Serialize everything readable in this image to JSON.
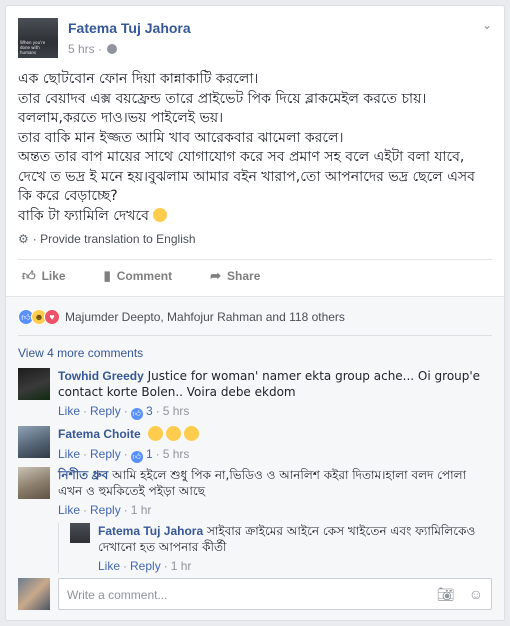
{
  "post": {
    "author": "Fatema Tuj Jahora",
    "avatar_caption": "When you're done with humans",
    "time": "5 hrs",
    "body_lines": [
      "এক ছোটবোন ফোন দিয়া কান্নাকাটি করলো।",
      "তার বেয়াদব এক্স বয়ফ্রেন্ড তারে প্রাইভেট পিক দিয়ে ব্লাকমেইল করতে চায়।",
      "বললাম,করতে দাও।ভয় পাইলেই ভয়।",
      "তার বাকি মান ইজ্জত আমি খাব আরেকবার ঝামেলা করলে।",
      "অন্তত তার বাপ মায়ের সাথে যোগাযোগ করে সব প্রমাণ সহ বলে এইটা বলা যাবে,",
      "দেখে ত ভদ্র ই মনে হয়।বুঝলাম আমার বইন খারাপ,তো আপনাদের ভদ্র ছেলে এসব",
      "কি করে বেড়াচ্ছে?",
      "বাকি টা ফ্যামিলি দেখবে"
    ],
    "translate": "Provide translation to English"
  },
  "actions": {
    "like": "Like",
    "comment": "Comment",
    "share": "Share"
  },
  "reactions": {
    "text": "Majumder Deepto, Mahfojur Rahman and 118 others"
  },
  "view_more": "View 4 more comments",
  "comments": [
    {
      "name": "Towhid Greedy",
      "text": "Justice for woman' namer ekta group ache... Oi group'e contact korte Bolen.. Voira debe ekdom",
      "like": "Like",
      "reply": "Reply",
      "likes": "3",
      "time": "5 hrs"
    },
    {
      "name": "Fatema Choite",
      "text": "",
      "like": "Like",
      "reply": "Reply",
      "likes": "1",
      "time": "5 hrs"
    },
    {
      "name": "নিশীত ধ্রুব",
      "text": "আমি হইলে শুধু পিক না,ভিডিও ও আনলিশ কইরা দিতাম।হালা বলদ পোলা এখন ও হুমকিতেই পইড়া আছে",
      "like": "Like",
      "reply": "Reply",
      "time": "1 hr"
    },
    {
      "name": "Fatema Tuj Jahora",
      "text": "সাইবার ক্রাইমের আইনে কেস খাইতেন এবং ফ্যামিলিকেও দেখানো হত আপনার কীর্তী",
      "like": "Like",
      "reply": "Reply",
      "time": "1 hr"
    }
  ],
  "write": {
    "placeholder": "Write a comment..."
  },
  "colors": {
    "link": "#365899",
    "like_blue": "#5890ff",
    "love_red": "#f25268",
    "haha_yellow": "#ffcc4d",
    "muted": "#90949c"
  }
}
